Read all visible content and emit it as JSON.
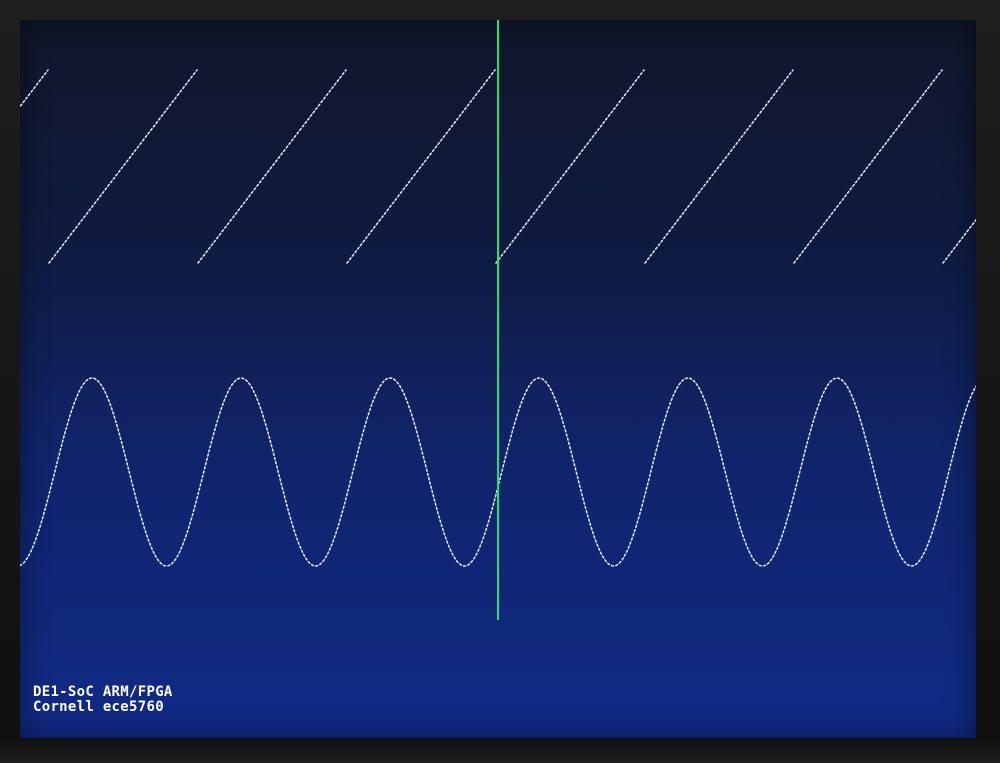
{
  "display": {
    "background_color": "#0f2470",
    "trace_color": "#e6ecff",
    "cursor_color": "#25e06d"
  },
  "waveforms": [
    {
      "shape": "sawtooth",
      "visible_cycles": 6.5
    },
    {
      "shape": "sine",
      "visible_cycles": 6.5
    }
  ],
  "cursor": {
    "orientation": "vertical",
    "position_fraction": 0.5
  },
  "caption": {
    "line1": "DE1-SoC ARM/FPGA",
    "line2": "Cornell ece5760"
  }
}
